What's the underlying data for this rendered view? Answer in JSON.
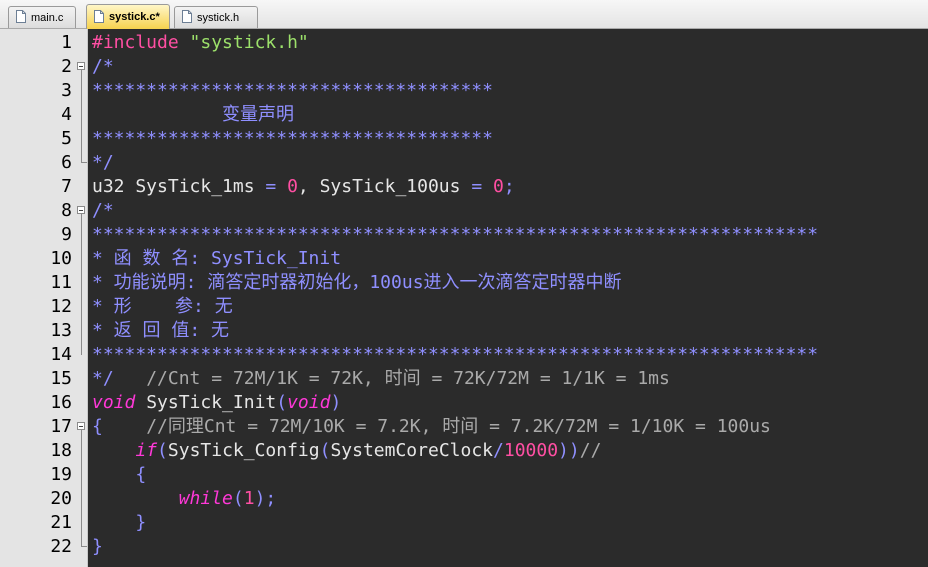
{
  "tabs": [
    {
      "label": "main.c",
      "active": false
    },
    {
      "label": "systick.c*",
      "active": true
    },
    {
      "label": "systick.h",
      "active": false
    }
  ],
  "lines": [
    {
      "n": "1",
      "tokens": [
        [
          "#include ",
          "pre"
        ],
        [
          "\"systick.h\"",
          "str"
        ]
      ]
    },
    {
      "n": "2",
      "tokens": [
        [
          "/*",
          "com"
        ]
      ]
    },
    {
      "n": "3",
      "tokens": [
        [
          "*************************************",
          "com"
        ]
      ]
    },
    {
      "n": "4",
      "tokens": [
        [
          "            变量声明",
          "com"
        ]
      ]
    },
    {
      "n": "5",
      "tokens": [
        [
          "*************************************",
          "com"
        ]
      ]
    },
    {
      "n": "6",
      "tokens": [
        [
          "*/",
          "com"
        ]
      ]
    },
    {
      "n": "7",
      "tokens": [
        [
          "u32 SysTick_1ms ",
          "id"
        ],
        [
          "=",
          "op"
        ],
        [
          " ",
          "id"
        ],
        [
          "0",
          "num"
        ],
        [
          ", SysTick_100us ",
          "id"
        ],
        [
          "=",
          "op"
        ],
        [
          " ",
          "id"
        ],
        [
          "0",
          "num"
        ],
        [
          ";",
          "op"
        ]
      ]
    },
    {
      "n": "8",
      "tokens": [
        [
          "/*",
          "com"
        ]
      ]
    },
    {
      "n": "9",
      "tokens": [
        [
          "*******************************************************************",
          "com"
        ]
      ]
    },
    {
      "n": "10",
      "tokens": [
        [
          "* 函 数 名: SysTick_Init",
          "com"
        ]
      ]
    },
    {
      "n": "11",
      "tokens": [
        [
          "* 功能说明: 滴答定时器初始化，100us进入一次滴答定时器中断",
          "com"
        ]
      ]
    },
    {
      "n": "12",
      "tokens": [
        [
          "* 形    参: 无",
          "com"
        ]
      ]
    },
    {
      "n": "13",
      "tokens": [
        [
          "* 返 回 值: 无",
          "com"
        ]
      ]
    },
    {
      "n": "14",
      "tokens": [
        [
          "*******************************************************************",
          "com"
        ]
      ]
    },
    {
      "n": "15",
      "tokens": [
        [
          "*/",
          "com"
        ],
        [
          "   //Cnt = 72M/1K = 72K, 时间 = 72K/72M = 1/1K = 1ms",
          "com2"
        ]
      ]
    },
    {
      "n": "16",
      "tokens": [
        [
          "void",
          "kw"
        ],
        [
          " SysTick_Init",
          "id"
        ],
        [
          "(",
          "op"
        ],
        [
          "void",
          "kw"
        ],
        [
          ")",
          "op"
        ]
      ]
    },
    {
      "n": "17",
      "tokens": [
        [
          "{",
          "op"
        ],
        [
          "    //同理Cnt = 72M/10K = 7.2K, 时间 = 7.2K/72M = 1/10K = 100us",
          "com2"
        ]
      ]
    },
    {
      "n": "18",
      "tokens": [
        [
          "    ",
          "id"
        ],
        [
          "if",
          "kw"
        ],
        [
          "(",
          "op"
        ],
        [
          "SysTick_Config",
          "id"
        ],
        [
          "(",
          "op"
        ],
        [
          "SystemCoreClock",
          "id"
        ],
        [
          "/",
          "op"
        ],
        [
          "10000",
          "num"
        ],
        [
          "))",
          "op"
        ],
        [
          "//",
          "com2"
        ]
      ]
    },
    {
      "n": "19",
      "tokens": [
        [
          "    ",
          "id"
        ],
        [
          "{",
          "op"
        ]
      ]
    },
    {
      "n": "20",
      "tokens": [
        [
          "        ",
          "id"
        ],
        [
          "while",
          "kw"
        ],
        [
          "(",
          "op"
        ],
        [
          "1",
          "num"
        ],
        [
          ");",
          "op"
        ]
      ]
    },
    {
      "n": "21",
      "tokens": [
        [
          "    ",
          "id"
        ],
        [
          "}",
          "op"
        ]
      ]
    },
    {
      "n": "22",
      "tokens": [
        [
          "}",
          "op"
        ]
      ]
    }
  ]
}
